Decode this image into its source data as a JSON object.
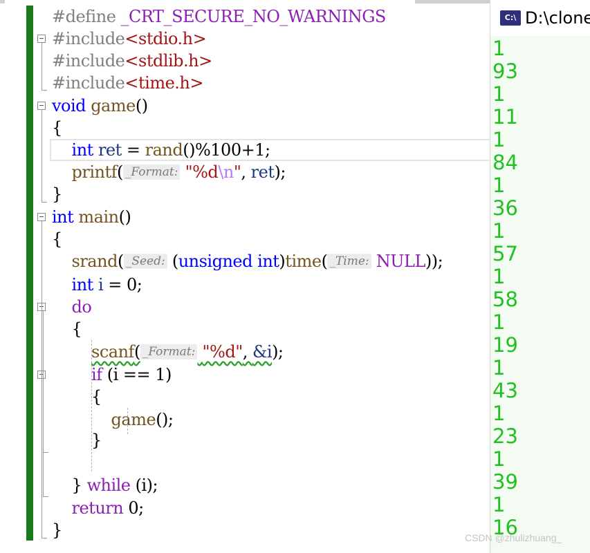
{
  "code": {
    "define_kw": "#define",
    "define_macro": "_CRT_SECURE_NO_WARNINGS",
    "include_kw": "#include",
    "include1": "<stdio.h>",
    "include2": "<stdlib.h>",
    "include3": "<time.h>",
    "void_kw": "void",
    "game_fn": "game",
    "parens": "()",
    "open_brace": "{",
    "close_brace": "}",
    "int_kw": "int",
    "ret_var": "ret",
    "assign": " = ",
    "rand_fn": "rand",
    "rand_rest": "()%100+1;",
    "printf_fn": "printf",
    "format_hint": "_Format:",
    "fmt_d": "\"%d",
    "fmt_n": "\\n",
    "fmt_end": "\"",
    "comma_space": ", ",
    "close_stmt": ");",
    "main_fn": "main",
    "srand_fn": "srand",
    "seed_hint": "_Seed:",
    "unsigned_kw": "unsigned",
    "time_fn": "time",
    "time_hint": "_Time:",
    "null_macro": "NULL",
    "close_srand": "));",
    "i_var": "i",
    "zero_stmt": " = 0;",
    "do_kw": "do",
    "scanf_fn": "scanf",
    "scanf_fmt": "\"%d\"",
    "amp_i": "&i",
    "if_kw": "if",
    "if_cond": " (i == 1)",
    "game_call": "game",
    "game_call_rest": "();",
    "while_kw": "while",
    "while_cond": " (i);",
    "return_kw": "return",
    "return_rest": " 0;"
  },
  "console": {
    "title": "D:\\clone",
    "icon_label": "C:\\",
    "output": [
      "1",
      "93",
      "1",
      "11",
      "1",
      "84",
      "1",
      "36",
      "1",
      "57",
      "1",
      "58",
      "1",
      "19",
      "1",
      "43",
      "1",
      "23",
      "1",
      "39",
      "1",
      "16"
    ]
  },
  "watermark": "CSDN @zhulizhuang_"
}
